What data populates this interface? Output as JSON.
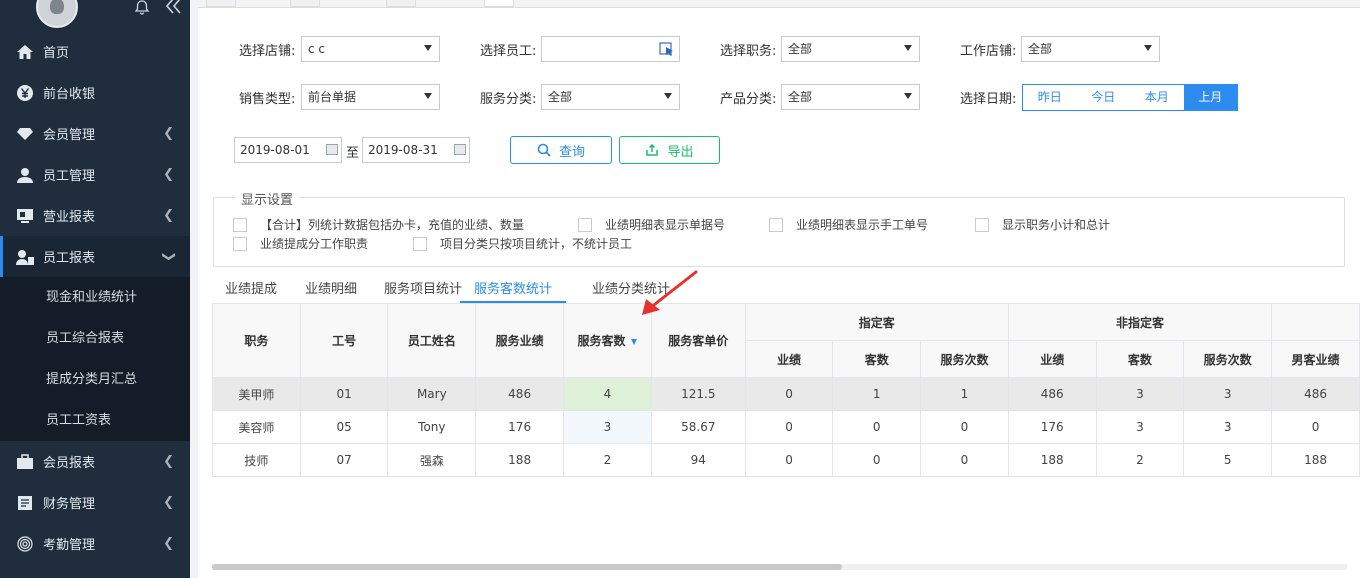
{
  "sidebar": {
    "items": [
      {
        "label": "首页",
        "icon": "home-icon"
      },
      {
        "label": "前台收银",
        "icon": "yen-icon"
      },
      {
        "label": "会员管理",
        "icon": "diamond-icon"
      },
      {
        "label": "员工管理",
        "icon": "user-icon"
      },
      {
        "label": "营业报表",
        "icon": "monitor-icon"
      },
      {
        "label": "员工报表",
        "icon": "staff-report-icon"
      },
      {
        "label": "会员报表",
        "icon": "briefcase-icon"
      },
      {
        "label": "财务管理",
        "icon": "finance-icon"
      },
      {
        "label": "考勤管理",
        "icon": "fingerprint-icon"
      }
    ],
    "sub_items": [
      "现金和业绩统计",
      "员工综合报表",
      "提成分类月汇总",
      "员工工资表"
    ]
  },
  "filters": {
    "store_label": "选择店铺:",
    "store_value": "c c",
    "employee_label": "选择员工:",
    "employee_value": "",
    "position_label": "选择职务:",
    "position_value": "全部",
    "work_store_label": "工作店铺:",
    "work_store_value": "全部",
    "sale_type_label": "销售类型:",
    "sale_type_value": "前台单据",
    "service_cat_label": "服务分类:",
    "service_cat_value": "全部",
    "product_cat_label": "产品分类:",
    "product_cat_value": "全部",
    "date_label": "选择日期:",
    "date_buttons": [
      "昨日",
      "今日",
      "本月",
      "上月"
    ],
    "date_active": "上月",
    "date_from": "2019-08-01",
    "date_to_sep": "至",
    "date_to": "2019-08-31",
    "query_label": "查询",
    "export_label": "导出"
  },
  "settings": {
    "title": "显示设置",
    "options": [
      "【合计】列统计数据包括办卡，充值的业绩、数量",
      "业绩明细表显示单据号",
      "业绩明细表显示手工单号",
      "显示职务小计和总计",
      "业绩提成分工作职责",
      "项目分类只按项目统计，不统计员工"
    ]
  },
  "report_tabs": [
    "业绩提成",
    "业绩明细",
    "服务项目统计",
    "服务客数统计",
    "业绩分类统计"
  ],
  "active_report_tab": "服务客数统计",
  "table": {
    "headers": {
      "position": "职务",
      "emp_no": "工号",
      "emp_name": "员工姓名",
      "service_perf": "服务业绩",
      "service_count": "服务客数",
      "unit_price": "服务客单价",
      "designated": "指定客",
      "non_designated": "非指定客",
      "perf": "业绩",
      "count": "客数",
      "times": "服务次数",
      "male_perf": "男客业绩"
    },
    "rows": [
      [
        "美甲师",
        "01",
        "Mary",
        "486",
        "4",
        "121.5",
        "0",
        "1",
        "1",
        "486",
        "3",
        "3",
        "486"
      ],
      [
        "美容师",
        "05",
        "Tony",
        "176",
        "3",
        "58.67",
        "0",
        "0",
        "0",
        "176",
        "3",
        "3",
        "0"
      ],
      [
        "技师",
        "07",
        "强森",
        "188",
        "2",
        "94",
        "0",
        "0",
        "0",
        "188",
        "2",
        "5",
        "188"
      ]
    ]
  },
  "colors": {
    "sidebar_bg": "#1f2d3d",
    "accent": "#2d8cf0",
    "export_green": "#19be6b",
    "annotation_red": "#e8312b"
  }
}
